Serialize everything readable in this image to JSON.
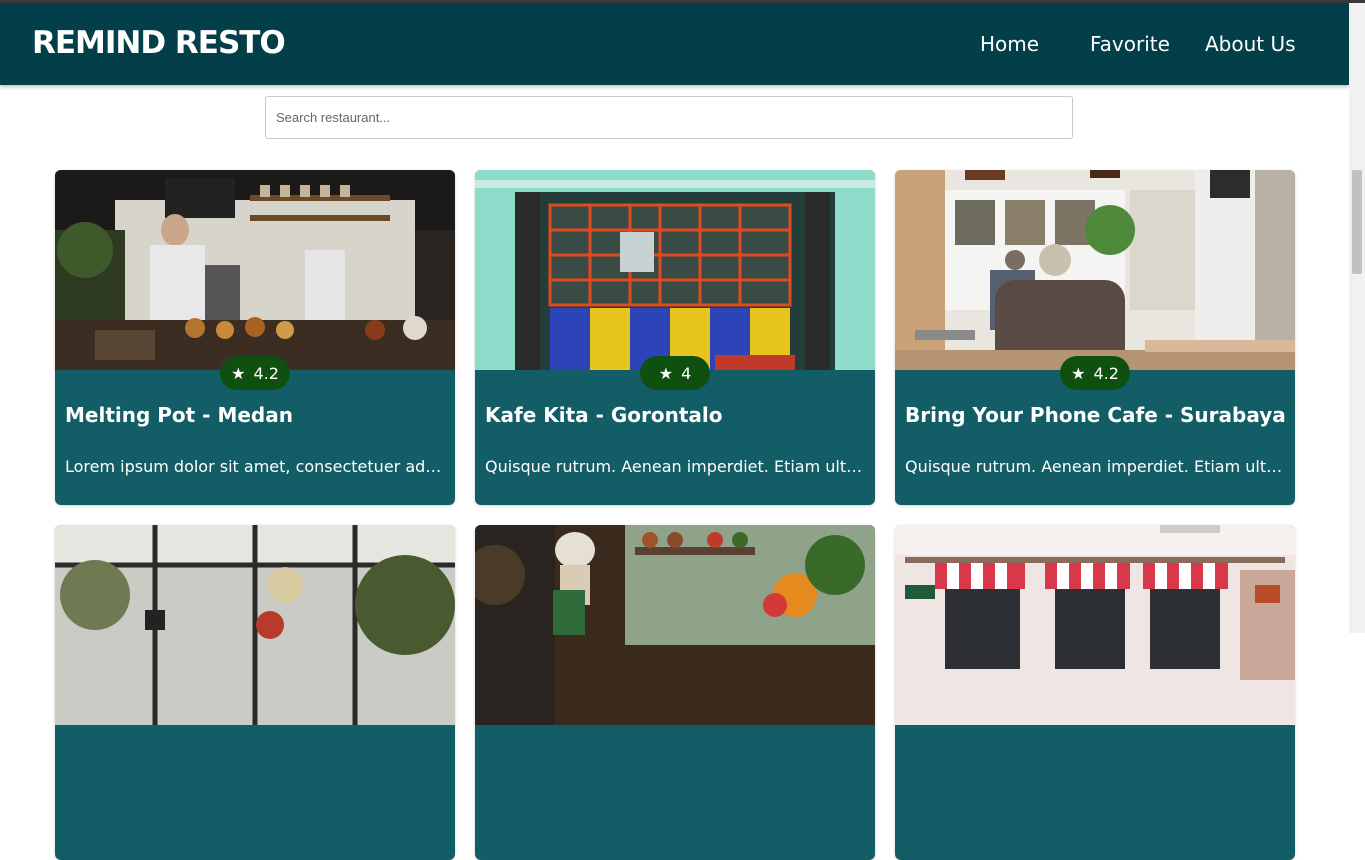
{
  "app": {
    "brand": "REMIND RESTO"
  },
  "nav": {
    "home": "Home",
    "favorite": "Favorite",
    "about": "About Us"
  },
  "search": {
    "placeholder": "Search restaurant...",
    "value": ""
  },
  "restaurants": [
    {
      "name": "Melting Pot - Medan",
      "rating": "4.2",
      "description": "Lorem ipsum dolor sit amet, consectetuer adipiscing elit. Aenean commodo ligula eget dolor."
    },
    {
      "name": "Kafe Kita - Gorontalo",
      "rating": "4",
      "description": "Quisque rutrum. Aenean imperdiet. Etiam ultricies nisi vel augue."
    },
    {
      "name": "Bring Your Phone Cafe - Surabaya",
      "rating": "4.2",
      "description": "Quisque rutrum. Aenean imperdiet. Etiam ultricies nisi vel augue."
    }
  ],
  "icons": {
    "rating": "star-icon"
  },
  "colors": {
    "header": "#033f48",
    "card": "#135d66",
    "rating_badge": "#0f4f0f"
  }
}
